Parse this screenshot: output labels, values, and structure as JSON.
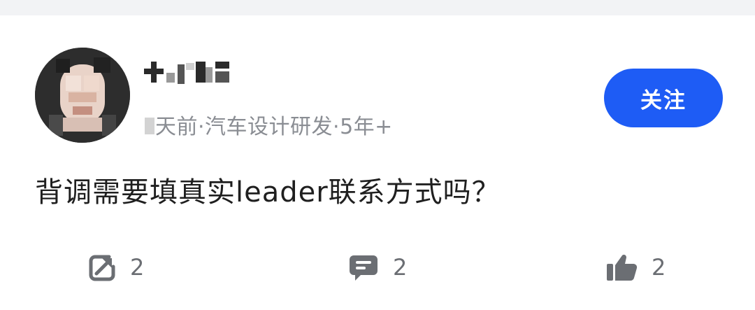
{
  "post": {
    "author": {
      "name": "",
      "meta_prefix": "",
      "meta": "天前·汽车设计研发·5年+"
    },
    "follow_label": "关注",
    "question": "背调需要填真实leader联系方式吗？",
    "actions": {
      "share": {
        "icon": "share-icon",
        "count": "2"
      },
      "comment": {
        "icon": "comment-icon",
        "count": "2"
      },
      "like": {
        "icon": "thumbs-up-icon",
        "count": "2"
      }
    }
  },
  "colors": {
    "accent": "#1e5cf5",
    "meta_text": "#8a8d93",
    "body_text": "#1f1f1f",
    "icon": "#6b6e73"
  }
}
